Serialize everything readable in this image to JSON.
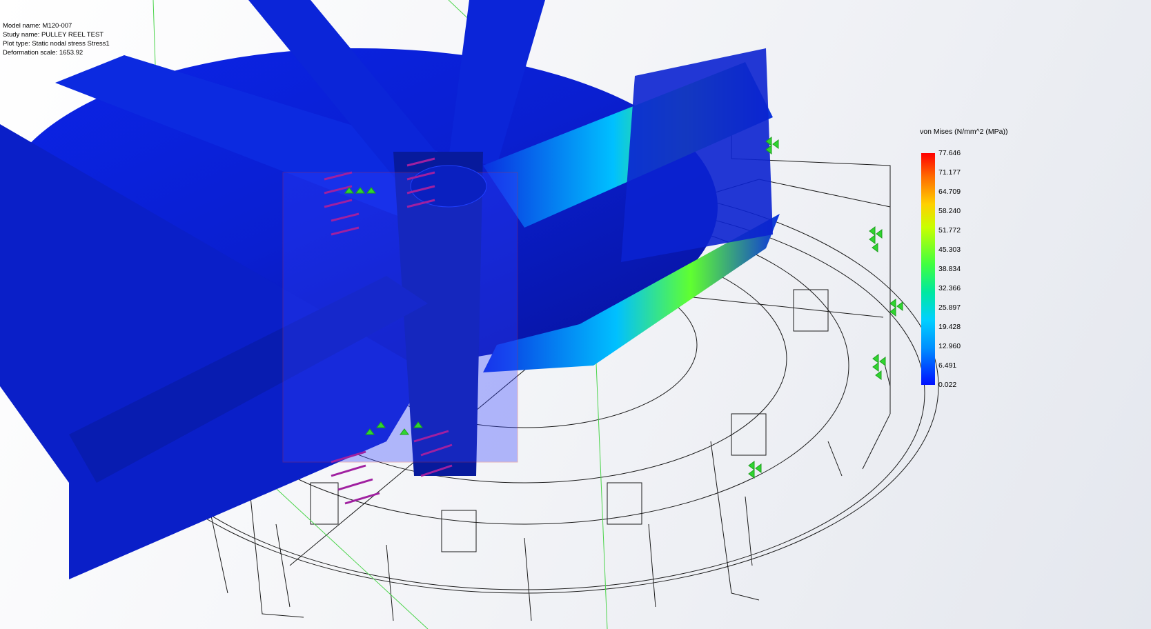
{
  "model_info": {
    "model_name": "Model name: M120-007",
    "study_name": "Study name: PULLEY REEL TEST",
    "plot_type": "Plot type: Static nodal stress Stress1",
    "deformation_scale": "Deformation scale: 1653.92"
  },
  "legend": {
    "title": "von Mises (N/mm^2 (MPa))",
    "ticks": [
      "77.646",
      "71.177",
      "64.709",
      "58.240",
      "51.772",
      "45.303",
      "38.834",
      "32.366",
      "25.897",
      "19.428",
      "12.960",
      "6.491",
      "0.022"
    ],
    "colors": {
      "max": "#ff0000",
      "high": "#ffd000",
      "mid": "#40ff40",
      "low": "#00d0ff",
      "min": "#0010ff"
    }
  },
  "colors": {
    "model_body": "#0a1fd0",
    "model_dark": "#071398",
    "wireframe": "#1a1a1a",
    "fixture_arrows": "#2fd52f",
    "load_arrows": "#a020a0",
    "guide_lines": "#4ad44a"
  }
}
